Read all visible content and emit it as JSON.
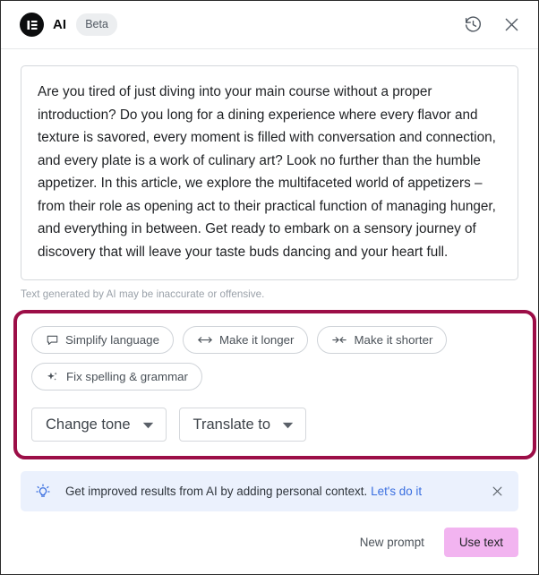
{
  "header": {
    "logo_icon": "elementor-logo-icon",
    "title": "AI",
    "badge": "Beta",
    "history_icon": "history-icon",
    "close_icon": "close-icon"
  },
  "main": {
    "generated_text": "Are you tired of just diving into your main course without a proper introduction? Do you long for a dining experience where every flavor and texture is savored, every moment is filled with conversation and connection, and every plate is a work of culinary art? Look no further than the humble appetizer. In this article, we explore the multifaceted world of appetizers – from their role as opening act to their practical function of managing hunger, and everything in between. Get ready to embark on a sensory journey of discovery that will leave your taste buds dancing and your heart full.",
    "disclaimer": "Text generated by AI may be inaccurate or offensive."
  },
  "actions": {
    "highlight_color": "#9c0e47",
    "chips": [
      {
        "label": "Simplify language",
        "icon": "speech-bubble-icon"
      },
      {
        "label": "Make it longer",
        "icon": "expand-arrows-icon"
      },
      {
        "label": "Make it shorter",
        "icon": "collapse-arrows-icon"
      },
      {
        "label": "Fix spelling & grammar",
        "icon": "sparkle-icon"
      }
    ],
    "dropdowns": [
      {
        "label": "Change tone",
        "icon": "chevron-down-icon"
      },
      {
        "label": "Translate to",
        "icon": "chevron-down-icon"
      }
    ]
  },
  "notice": {
    "icon": "lightbulb-icon",
    "text": "Get improved results from AI by adding personal context.",
    "link": "Let's do it",
    "link_color": "#3a6fe0",
    "background": "#ebf1fd",
    "close_icon": "close-icon"
  },
  "footer": {
    "new_prompt": "New prompt",
    "use_text": "Use text",
    "use_text_color": "#f2b4f0"
  }
}
